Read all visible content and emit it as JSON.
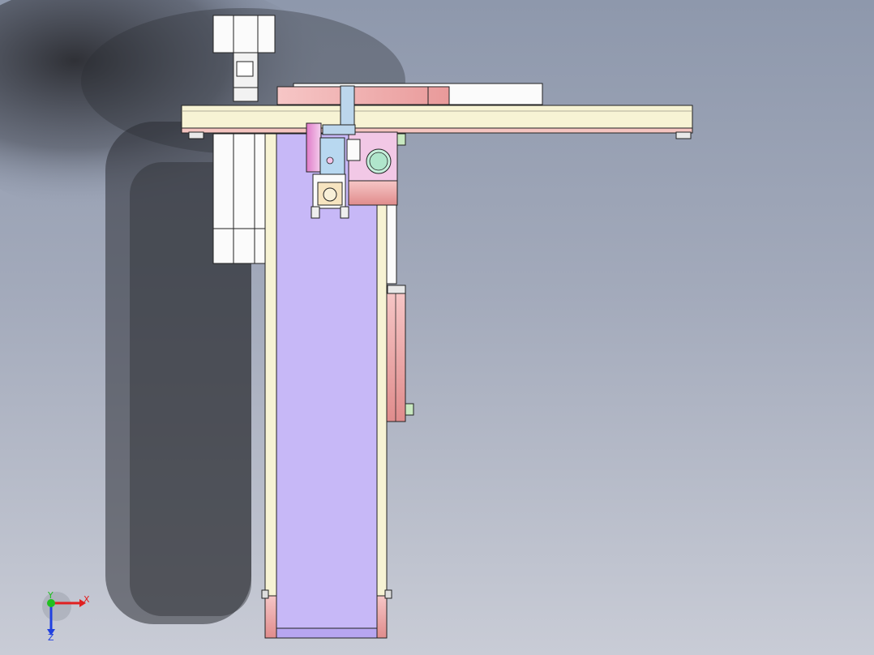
{
  "triad": {
    "x_label": "X",
    "y_label": "Y",
    "z_label": "Z",
    "x_color": "#e02020",
    "y_color": "#20c020",
    "z_color": "#2040e0"
  },
  "colors": {
    "lavender": "#c7b8f7",
    "pink": "#f2b8b8",
    "cream": "#f7f3d4",
    "white_part": "#fbfbfb",
    "salmon": "#f4c4c0",
    "outline": "#222222"
  }
}
